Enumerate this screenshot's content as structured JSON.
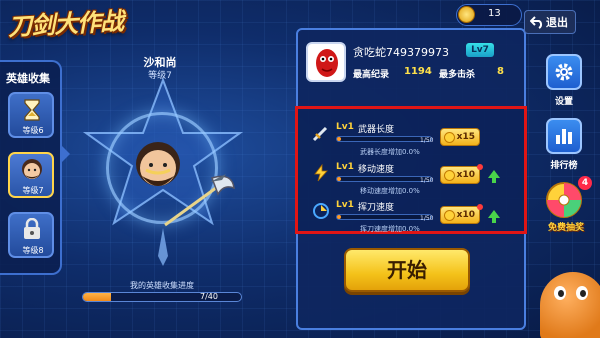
{
  "logo": {
    "text": "刀剑大作战"
  },
  "top": {
    "coins": "13",
    "exit_label": "退出"
  },
  "sidebar": {
    "title": "英雄收集",
    "slots": [
      {
        "level": "等级6",
        "icon": "hourglass-icon",
        "locked": false
      },
      {
        "level": "等级7",
        "icon": "hero-portrait-icon",
        "locked": false
      },
      {
        "level": "等级8",
        "icon": "lock-icon",
        "locked": true
      }
    ]
  },
  "hero": {
    "name": "沙和尚",
    "level": "等级7",
    "progress_label": "我的英雄收集进度",
    "progress_text": "7/40",
    "progress_fraction": 0.175
  },
  "player": {
    "name": "贪吃蛇749379973",
    "level_badge": "Lv7",
    "high_score_label": "最高纪录",
    "high_score": "1194",
    "kills_label": "最多击杀",
    "kills": "8"
  },
  "upgrades": [
    {
      "lv": "Lv1",
      "name": "武器长度",
      "progress": "1/50",
      "desc": "武器长度增加0.0%",
      "cost": "x15",
      "icon": "sword-icon",
      "show_arrow": false,
      "show_dot": false
    },
    {
      "lv": "Lv1",
      "name": "移动速度",
      "progress": "1/50",
      "desc": "移动速度增加0.0%",
      "cost": "x10",
      "icon": "lightning-icon",
      "show_arrow": true,
      "show_dot": true
    },
    {
      "lv": "Lv1",
      "name": "挥刀速度",
      "progress": "1/50",
      "desc": "挥刀速度增加0.0%",
      "cost": "x10",
      "icon": "swing-icon",
      "show_arrow": true,
      "show_dot": true
    }
  ],
  "start_button": {
    "label": "开始"
  },
  "side_menu": {
    "settings_label": "设置",
    "ranking_label": "排行榜",
    "lottery_label": "免费抽奖",
    "lottery_badge": "4"
  },
  "colors": {
    "background": "#0f2d6b",
    "panel_border": "#4a7fe0",
    "highlight_box": "#e01515",
    "start_button": "#f4c21a"
  }
}
